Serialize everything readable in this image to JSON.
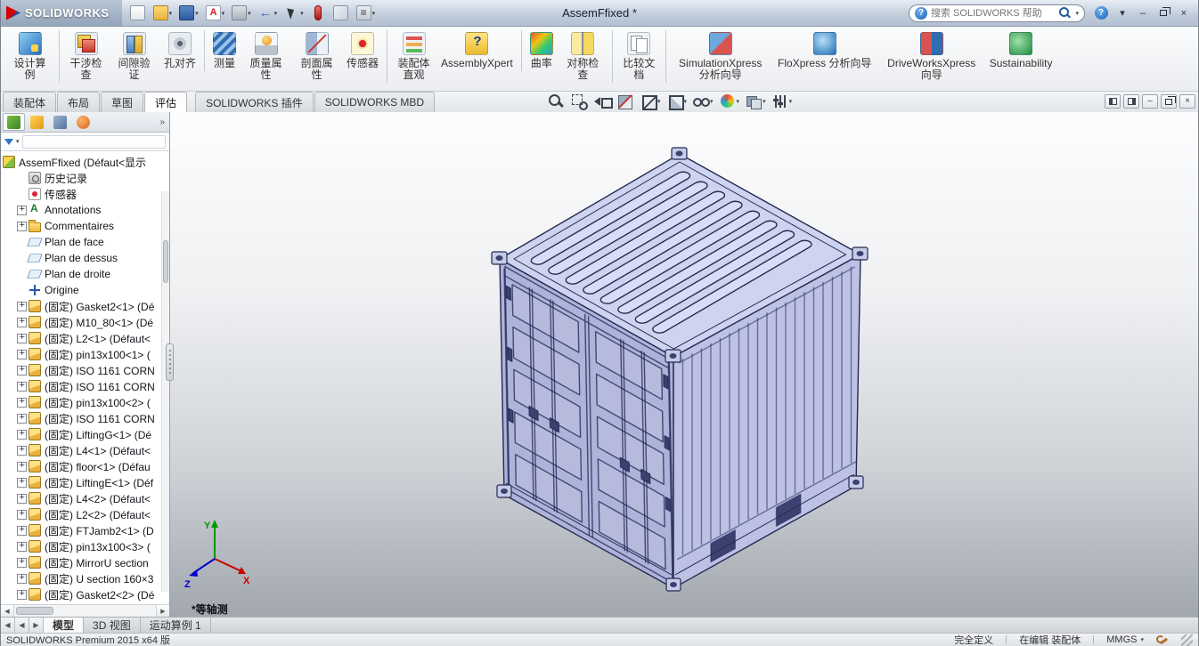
{
  "titlebar": {
    "app_name": "SOLIDWORKS",
    "document_title": "AssemFfixed *",
    "search_placeholder": "搜索 SOLIDWORKS 帮助",
    "tools": [
      {
        "icon": "new-doc"
      },
      {
        "icon": "open",
        "arrow": "▾"
      },
      {
        "icon": "save",
        "arrow": "▾"
      },
      {
        "icon": "appearance",
        "arrow": "▾"
      },
      {
        "icon": "print",
        "arrow": "▾"
      },
      {
        "icon": "undo",
        "arrow": "▾"
      },
      {
        "icon": "select",
        "arrow": "▾"
      },
      {
        "icon": "sensor-red"
      },
      {
        "icon": "box"
      },
      {
        "icon": "options",
        "arrow": "▾"
      }
    ]
  },
  "ribbon": {
    "items": [
      {
        "label": "设计算例",
        "icon": "design-study",
        "w": "n"
      },
      {
        "label": "干涉检查",
        "icon": "interference",
        "w": "n",
        "sep": "sep"
      },
      {
        "label": "间隙验证",
        "icon": "clearance",
        "w": "n"
      },
      {
        "label": "孔对齐",
        "icon": "hole",
        "w": "m"
      },
      {
        "label": "测量",
        "icon": "measure",
        "w": "m",
        "sep": "sep"
      },
      {
        "label": "质量属性",
        "icon": "mass",
        "w": "n"
      },
      {
        "label": "剖面属性",
        "icon": "section-prop",
        "w": "n"
      },
      {
        "label": "传感器",
        "icon": "sensor",
        "w": "m"
      },
      {
        "label": "装配体直观",
        "icon": "visualization",
        "w": "n",
        "sep": "sep"
      },
      {
        "label": "AssemblyXpert",
        "icon": "assemblyxpert",
        "w": "m"
      },
      {
        "label": "曲率",
        "icon": "curvature",
        "w": "m",
        "sep": "sep"
      },
      {
        "label": "对称检查",
        "icon": "symmetry",
        "w": "n"
      },
      {
        "label": "比较文档",
        "icon": "compare",
        "w": "n",
        "sep": "sep"
      },
      {
        "label": "SimulationXpress 分析向导",
        "icon": "simulationxpress",
        "w": "w",
        "sep": "sep"
      },
      {
        "label": "FloXpress 分析向导",
        "icon": "floxpress",
        "w": "w"
      },
      {
        "label": "DriveWorksXpress 向导",
        "icon": "driveworksxpress",
        "w": "w"
      },
      {
        "label": "Sustainability",
        "icon": "sustainability",
        "w": "m"
      }
    ]
  },
  "command_tabs": [
    {
      "label": "装配体"
    },
    {
      "label": "布局"
    },
    {
      "label": "草图"
    },
    {
      "label": "评估",
      "state": "active"
    },
    {
      "label": "SOLIDWORKS 插件",
      "state": "group"
    },
    {
      "label": "SOLIDWORKS MBD"
    }
  ],
  "headsup": [
    {
      "icon": "zoom-fit"
    },
    {
      "icon": "zoom-area"
    },
    {
      "icon": "previous-view"
    },
    {
      "icon": "section-view"
    },
    {
      "icon": "view-orientation",
      "arrow": "▾"
    },
    {
      "icon": "display-style",
      "arrow": "▾"
    },
    {
      "icon": "hide-show",
      "arrow": "▾"
    },
    {
      "icon": "edit-appearance",
      "arrow": "▾"
    },
    {
      "icon": "scene",
      "arrow": "▾"
    },
    {
      "icon": "view-settings",
      "arrow": "▾"
    }
  ],
  "panel_tabs": [
    {
      "icon": "feature-manager",
      "state": "active"
    },
    {
      "icon": "property-manager"
    },
    {
      "icon": "configuration-manager"
    },
    {
      "icon": "display-manager"
    }
  ],
  "feature_tree": {
    "root": {
      "label": "AssemFfixed (Défaut<显示"
    },
    "items": [
      {
        "label": "历史记录",
        "icon": "history",
        "exp": "none"
      },
      {
        "label": "传感器",
        "icon": "sensors",
        "exp": "none"
      },
      {
        "label": "Annotations",
        "icon": "annotations",
        "exp": "plus"
      },
      {
        "label": "Commentaires",
        "icon": "folder",
        "exp": "plus"
      },
      {
        "label": "Plan de face",
        "icon": "plane",
        "exp": "none"
      },
      {
        "label": "Plan de dessus",
        "icon": "plane",
        "exp": "none"
      },
      {
        "label": "Plan de droite",
        "icon": "plane",
        "exp": "none"
      },
      {
        "label": "Origine",
        "icon": "origin",
        "exp": "none"
      },
      {
        "label": "(固定) Gasket2<1> (Dé",
        "icon": "part",
        "exp": "plus"
      },
      {
        "label": "(固定) M10_80<1> (Dé",
        "icon": "part",
        "exp": "plus"
      },
      {
        "label": "(固定) L2<1> (Défaut<",
        "icon": "part",
        "exp": "plus"
      },
      {
        "label": "(固定) pin13x100<1> (",
        "icon": "part",
        "exp": "plus"
      },
      {
        "label": "(固定) ISO 1161 CORN",
        "icon": "part",
        "exp": "plus"
      },
      {
        "label": "(固定) ISO 1161 CORN",
        "icon": "part",
        "exp": "plus"
      },
      {
        "label": "(固定) pin13x100<2> (",
        "icon": "part",
        "exp": "plus"
      },
      {
        "label": "(固定) ISO 1161 CORN",
        "icon": "part",
        "exp": "plus"
      },
      {
        "label": "(固定) LiftingG<1> (Dé",
        "icon": "part",
        "exp": "plus"
      },
      {
        "label": "(固定) L4<1> (Défaut<",
        "icon": "part",
        "exp": "plus"
      },
      {
        "label": "(固定) floor<1> (Défau",
        "icon": "part",
        "exp": "plus"
      },
      {
        "label": "(固定) LiftingE<1> (Déf",
        "icon": "part",
        "exp": "plus"
      },
      {
        "label": "(固定) L4<2> (Défaut<",
        "icon": "part",
        "exp": "plus"
      },
      {
        "label": "(固定) L2<2> (Défaut<",
        "icon": "part",
        "exp": "plus"
      },
      {
        "label": "(固定) FTJamb2<1> (D",
        "icon": "part",
        "exp": "plus"
      },
      {
        "label": "(固定) pin13x100<3> (",
        "icon": "part",
        "exp": "plus"
      },
      {
        "label": "(固定) MirrorU section",
        "icon": "part",
        "exp": "plus"
      },
      {
        "label": "(固定) U section 160×3",
        "icon": "part",
        "exp": "plus"
      },
      {
        "label": "(固定) Gasket2<2> (Dé",
        "icon": "part",
        "exp": "plus"
      }
    ]
  },
  "viewport": {
    "view_label": "*等轴测",
    "triad": {
      "x": "X",
      "y": "Y",
      "z": "Z"
    }
  },
  "bottom_tabs": [
    {
      "label": "模型",
      "state": "active"
    },
    {
      "label": "3D 视图"
    },
    {
      "label": "运动算例 1"
    }
  ],
  "statusbar": {
    "product": "SOLIDWORKS Premium 2015 x64 版",
    "defined": "完全定义",
    "editing": "在编辑 装配体",
    "units": "MMGS"
  },
  "glyphs": {
    "dropdown": "▾",
    "chevron": "»",
    "left": "◀",
    "right": "▶",
    "minimize": "–",
    "close": "×",
    "help": "?"
  },
  "colors": {
    "edge": "#242a52",
    "top": "#ced3f0",
    "front": "#aeb3da",
    "side": "#bdc2e4",
    "rib": "#d8dcf6",
    "casting": "#c6cbe8",
    "detail": "#3c4270",
    "axis_x": "#cc0000",
    "axis_y": "#009900",
    "axis_z": "#0000cc"
  }
}
